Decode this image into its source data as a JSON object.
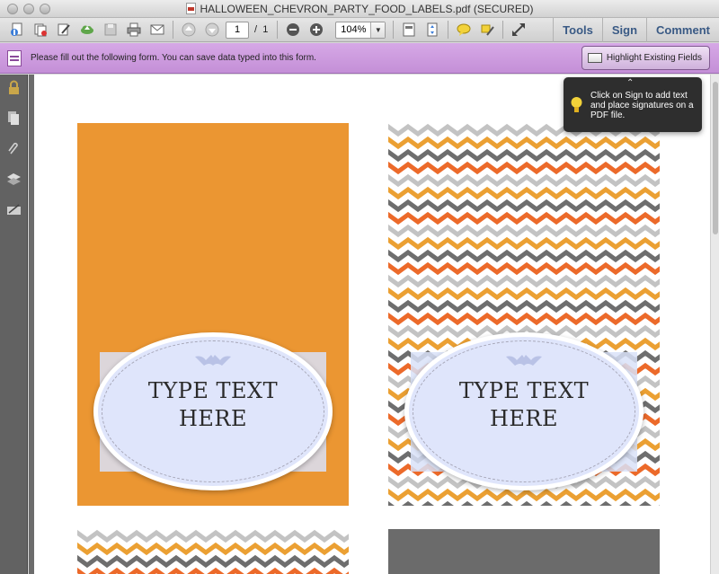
{
  "window": {
    "title": "HALLOWEEN_CHEVRON_PARTY_FOOD_LABELS.pdf (SECURED)"
  },
  "toolbar": {
    "page_current": "1",
    "page_separator": "/",
    "page_total": "1",
    "zoom": "104%",
    "tools_label": "Tools",
    "sign_label": "Sign",
    "comment_label": "Comment"
  },
  "formbar": {
    "message": "Please fill out the following form. You can save data typed into this form.",
    "highlight_label": "Highlight Existing Fields"
  },
  "tooltip": {
    "text": "Click on Sign to add text and place signatures on a PDF file."
  },
  "labels": [
    {
      "line1": "TYPE TEXT",
      "line2": "HERE"
    },
    {
      "line1": "TYPE TEXT",
      "line2": "HERE"
    }
  ],
  "colors": {
    "orange": "#eb9632",
    "chevron_orange": "#ec6a2a",
    "chevron_gold": "#eba033",
    "chevron_gray": "#6e6e6e",
    "chevron_light": "#c3c3c3",
    "formbar": "#c48fd7",
    "accent": "#3a5a85"
  }
}
